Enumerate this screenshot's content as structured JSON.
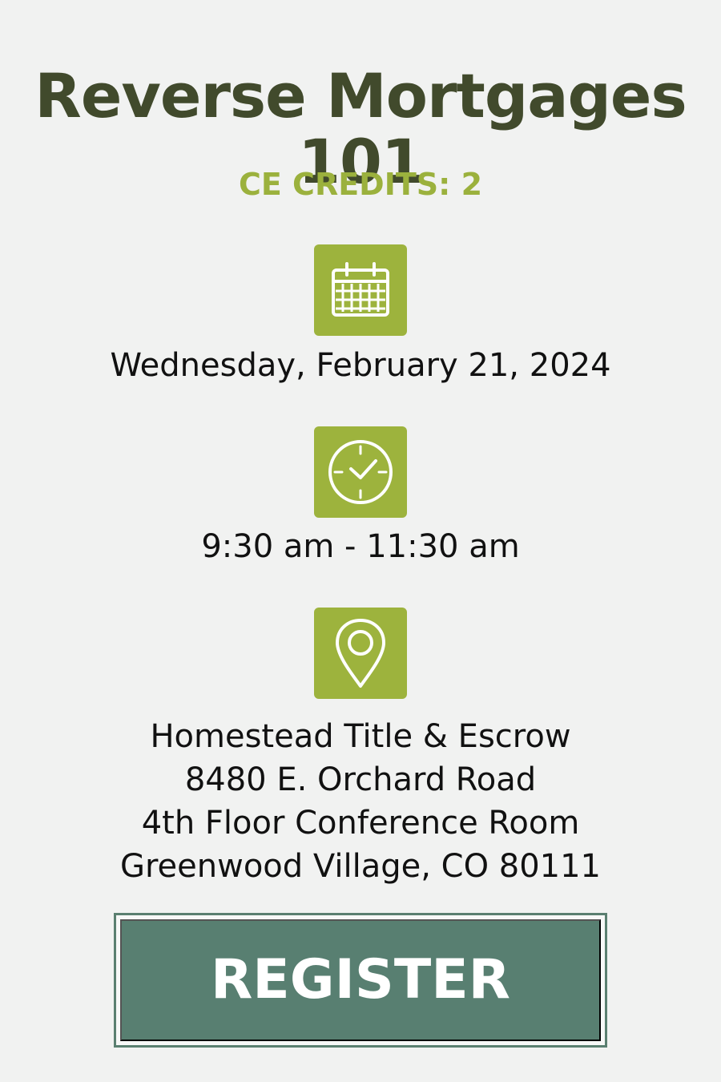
{
  "event": {
    "title_line_1": "Reverse Mortgages",
    "title_line_2": "101",
    "credits": "CE CREDITS: 2",
    "date": "Wednesday, February 21, 2024",
    "time": "9:30 am - 11:30 am",
    "location": {
      "line_1": "Homestead Title & Escrow",
      "line_2": "8480 E. Orchard Road",
      "line_3": "4th Floor Conference Room",
      "line_4": "Greenwood Village, CO 80111"
    }
  },
  "actions": {
    "register_label": "REGISTER"
  },
  "icons": {
    "date": "calendar-icon",
    "time": "clock-icon",
    "location": "location-pin-icon"
  },
  "colors": {
    "background": "#f1f2f1",
    "title": "#414a2c",
    "accent": "#9db33d",
    "button": "#587f71",
    "text": "#111111"
  }
}
